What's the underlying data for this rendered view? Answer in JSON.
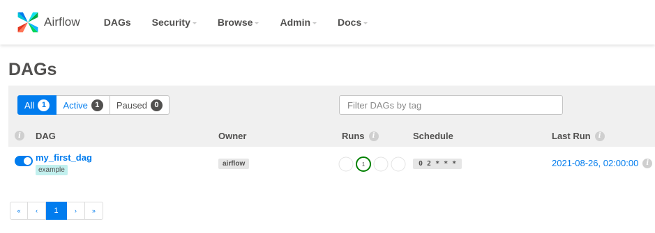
{
  "nav": {
    "brand": "Airflow",
    "items": [
      {
        "label": "DAGs",
        "has_caret": false
      },
      {
        "label": "Security",
        "has_caret": true
      },
      {
        "label": "Browse",
        "has_caret": true
      },
      {
        "label": "Admin",
        "has_caret": true
      },
      {
        "label": "Docs",
        "has_caret": true
      }
    ]
  },
  "page": {
    "title": "DAGs"
  },
  "filters": {
    "status": [
      {
        "label": "All",
        "count": "1",
        "active": true
      },
      {
        "label": "Active",
        "count": "1",
        "active": false
      },
      {
        "label": "Paused",
        "count": "0",
        "active": false
      }
    ],
    "tag_placeholder": "Filter DAGs by tag"
  },
  "table": {
    "columns": {
      "dag": "DAG",
      "owner": "Owner",
      "runs": "Runs",
      "schedule": "Schedule",
      "last_run": "Last Run"
    },
    "rows": [
      {
        "dag_id": "my_first_dag",
        "tag": "example",
        "owner": "airflow",
        "schedule": "0 2 * * *",
        "last_run": "2021-08-26, 02:00:00",
        "is_active": true,
        "runs": {
          "success": "1",
          "success_color": "#008000"
        }
      }
    ]
  },
  "pagination": {
    "first": "«",
    "prev": "‹",
    "current": "1",
    "next": "›",
    "last": "»"
  },
  "colors": {
    "accent": "#017cee",
    "success": "#008000",
    "tag": "#c2f0ee"
  },
  "icons": {
    "logo": "airflow-pinwheel-logo",
    "info": "info-icon"
  }
}
